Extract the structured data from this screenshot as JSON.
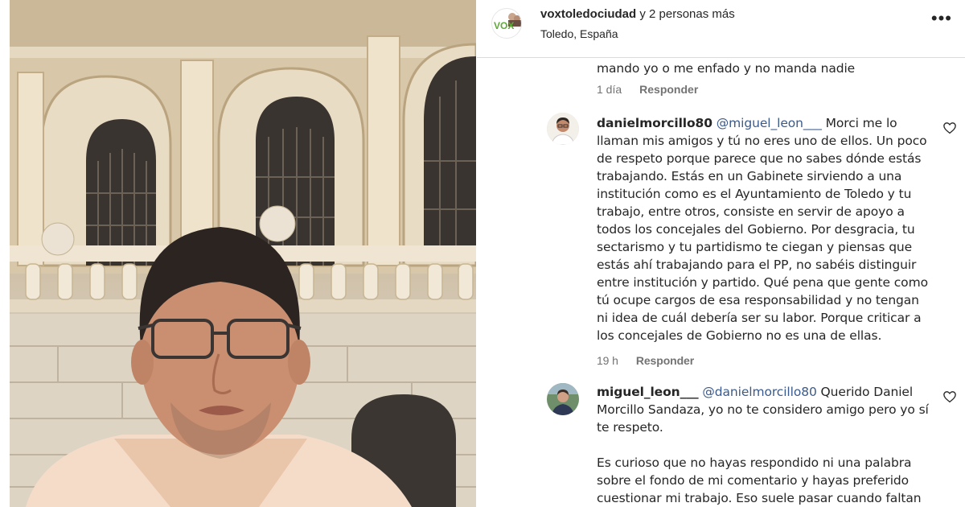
{
  "post": {
    "author_line": "voxtoledociudad",
    "author_suffix": " y 2 personas más",
    "location": "Toledo, España",
    "avatar_text": "VOX",
    "more_label": "•••"
  },
  "comments": [
    {
      "text": "mando yo o me enfado y no manda nadie",
      "time": "1 día",
      "reply": "Responder"
    },
    {
      "username": "danielmorcillo80",
      "mention": "@miguel_leon___",
      "text_line1_rest": " Morci me lo",
      "lines": [
        "llaman mis amigos y tú no eres uno de ellos. Un poco",
        "de respeto porque parece que no sabes dónde estás",
        "trabajando. Estás en un Gabinete sirviendo a una",
        "institución como es el Ayuntamiento de Toledo y tu",
        "trabajo, entre otros, consiste en servir de apoyo a",
        "todos los concejales del Gobierno. Por desgracia, tu",
        "sectarismo y tu partidismo te ciegan y piensas que",
        "estás ahí trabajando para el PP, no sabéis distinguir",
        "entre institución y partido. Qué pena que gente como",
        "tú ocupe cargos de esa responsabilidad y no tengan",
        "ni idea de cuál debería ser su labor. Porque criticar a",
        "los concejales de Gobierno no es una de ellas."
      ],
      "time": "19 h",
      "reply": "Responder"
    },
    {
      "username": "miguel_leon___",
      "mention": "@danielmorcillo80",
      "text_line1_rest": " Querido Daniel",
      "lines": [
        "Morcillo Sandaza, yo no te considero amigo pero yo sí",
        "te respeto.",
        "",
        "Es curioso que no hayas respondido ni una palabra",
        "sobre el fondo de mi comentario y hayas preferido",
        "cuestionar mi trabajo. Eso suele pasar cuando faltan"
      ]
    }
  ],
  "colors": {
    "mention": "#3a5a8c",
    "meta": "#737373",
    "vox_green": "#5fa83a"
  }
}
